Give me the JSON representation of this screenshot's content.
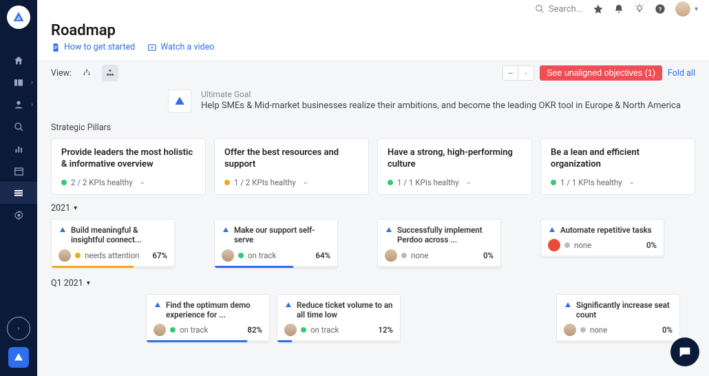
{
  "header": {
    "title": "Roadmap",
    "links": {
      "howto": "How to get started",
      "video": "Watch a video"
    },
    "search_placeholder": "Search..."
  },
  "toolbar": {
    "view_label": "View:",
    "unaligned": "See unaligned objectives (1)",
    "fold_all": "Fold all"
  },
  "goal": {
    "label": "Ultimate Goal",
    "text": "Help SMEs & Mid-market businesses realize their ambitions, and become the leading OKR tool in Europe & North America"
  },
  "sections": {
    "pillars_label": "Strategic Pillars",
    "period_2021": "2021",
    "period_q1": "Q1 2021"
  },
  "pillars": [
    {
      "title": "Provide leaders the most holistic & informative overview",
      "kpi": "2 / 2 KPIs healthy",
      "dot": "green"
    },
    {
      "title": "Offer the best resources and support",
      "kpi": "1 / 2 KPIs healthy",
      "dot": "orange"
    },
    {
      "title": "Have a strong, high-performing culture",
      "kpi": "1 / 1 KPIs healthy",
      "dot": "green"
    },
    {
      "title": "Be a lean and efficient organization",
      "kpi": "1 / 1 KPIs healthy",
      "dot": "green"
    }
  ],
  "objectives_2021": [
    {
      "title": "Build meaningful & insightful connect...",
      "status": "needs attention",
      "dot": "orange",
      "pct": "67%",
      "pctnum": 67,
      "barclass": "orange"
    },
    {
      "title": "Make our support self-serve",
      "status": "on track",
      "dot": "green",
      "pct": "64%",
      "pctnum": 64,
      "barclass": ""
    },
    {
      "title": "Successfully implement Perdoo across ...",
      "status": "none",
      "dot": "grey",
      "pct": "0%",
      "pctnum": 0,
      "barclass": "none"
    },
    {
      "title": "Automate repetitive tasks",
      "status": "none",
      "dot": "grey",
      "pct": "0%",
      "pctnum": 0,
      "barclass": "none",
      "owner": "red"
    }
  ],
  "objectives_q1": {
    "col1": [
      {
        "title": "Find the optimum demo experience for ...",
        "status": "on track",
        "dot": "green",
        "pct": "82%",
        "pctnum": 82
      },
      {
        "title": "Reduce ticket volume to an all time low",
        "status": "on track",
        "dot": "green",
        "pct": "12%",
        "pctnum": 12
      }
    ],
    "col3": [
      {
        "title": "Significantly increase seat count",
        "status": "none",
        "dot": "grey",
        "pct": "0%",
        "pctnum": 0
      }
    ]
  }
}
